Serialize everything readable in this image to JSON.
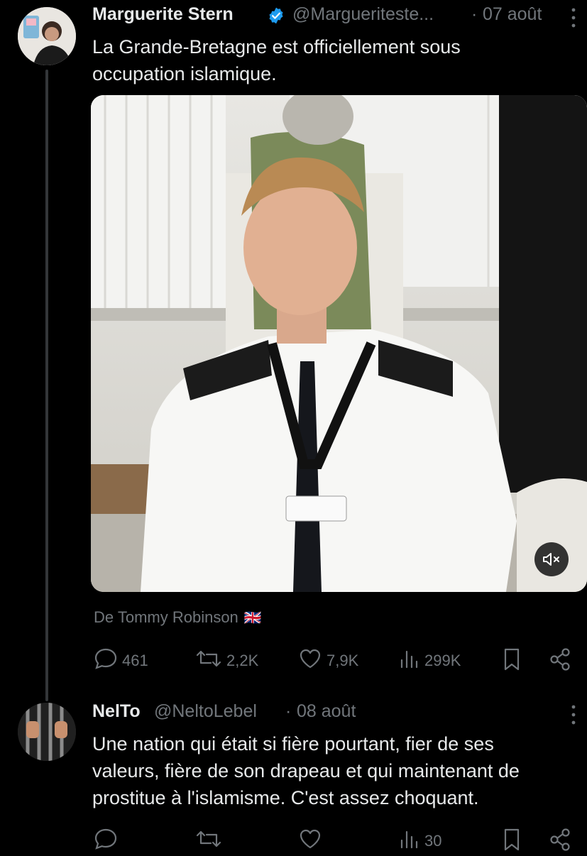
{
  "tweet": {
    "author_name": "Marguerite Stern",
    "handle": "@Margueriteste...",
    "separator": "·",
    "date": "07 août",
    "text_line1": "La Grande-Bretagne est officiellement sous",
    "text_line2": "occupation islamique.",
    "source_label": "De Tommy Robinson",
    "source_flag": "🇬🇧",
    "stats": {
      "replies": "461",
      "reposts": "2,2K",
      "likes": "7,9K",
      "views": "299K"
    },
    "verified_color": "#1d9bf0"
  },
  "reply": {
    "author_name": "NelTo",
    "handle": "@NeltoLebel",
    "separator": "·",
    "date": "08 août",
    "text_line1": "Une nation qui était si fière pourtant, fier de ses",
    "text_line2": "valeurs, fière de son drapeau et qui maintenant de",
    "text_line3": "prostitue à l'islamisme. C'est assez choquant.",
    "stats": {
      "views": "30"
    }
  },
  "icons": {
    "more": "more-vertical-icon",
    "reply": "speech-bubble-icon",
    "repost": "repost-arrows-icon",
    "like": "heart-icon",
    "views": "bar-chart-icon",
    "bookmark": "bookmark-icon",
    "share": "share-icon",
    "mute": "speaker-muted-icon"
  }
}
